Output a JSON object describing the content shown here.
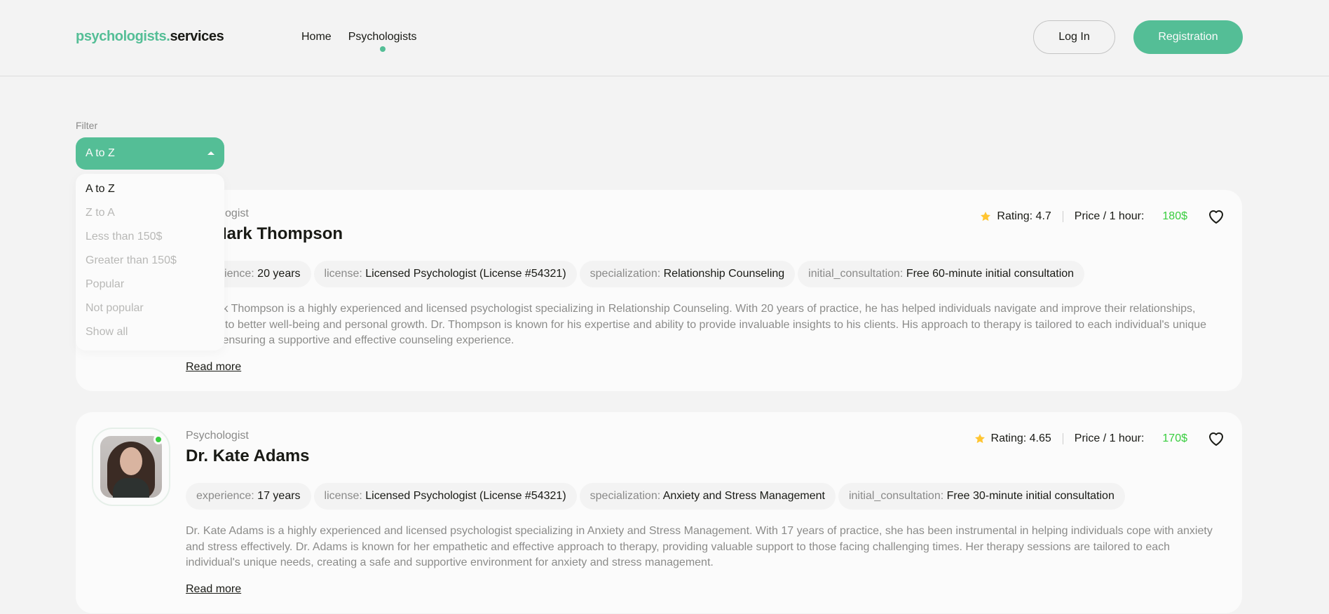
{
  "header": {
    "logo_accent": "psychologists.",
    "logo_rest": "services",
    "nav": [
      {
        "label": "Home",
        "active": false
      },
      {
        "label": "Psychologists",
        "active": true
      }
    ],
    "login_label": "Log In",
    "register_label": "Registration"
  },
  "filter": {
    "label": "Filter",
    "selected": "A to Z",
    "options": [
      "A to Z",
      "Z to A",
      "Less than 150$",
      "Greater than 150$",
      "Popular",
      "Not popular",
      "Show all"
    ]
  },
  "cards": [
    {
      "role": "Psychologist",
      "name": "Dr. Mark Thompson",
      "rating_text": "Rating: 4.7",
      "price_label": "Price / 1 hour:",
      "price": "180$",
      "online": true,
      "tags": [
        {
          "key": "experience",
          "value": "20 years"
        },
        {
          "key": "license",
          "value": "Licensed Psychologist (License #54321)"
        },
        {
          "key": "specialization",
          "value": "Relationship Counseling"
        },
        {
          "key": "initial_consultation",
          "value": "Free 60-minute initial consultation"
        }
      ],
      "description": "Dr. Mark Thompson is a highly experienced and licensed psychologist specializing in Relationship Counseling. With 20 years of practice, he has helped individuals navigate and improve their relationships, leading to better well-being and personal growth. Dr. Thompson is known for his expertise and ability to provide invaluable insights to his clients. His approach to therapy is tailored to each individual's unique needs, ensuring a supportive and effective counseling experience.",
      "read_more": "Read more"
    },
    {
      "role": "Psychologist",
      "name": "Dr. Kate Adams",
      "rating_text": "Rating: 4.65",
      "price_label": "Price / 1 hour:",
      "price": "170$",
      "online": true,
      "tags": [
        {
          "key": "experience",
          "value": "17 years"
        },
        {
          "key": "license",
          "value": "Licensed Psychologist (License #54321)"
        },
        {
          "key": "specialization",
          "value": "Anxiety and Stress Management"
        },
        {
          "key": "initial_consultation",
          "value": "Free 30-minute initial consultation"
        }
      ],
      "description": "Dr. Kate Adams is a highly experienced and licensed psychologist specializing in Anxiety and Stress Management. With 17 years of practice, she has been instrumental in helping individuals cope with anxiety and stress effectively. Dr. Adams is known for her empathetic and effective approach to therapy, providing valuable support to those facing challenging times. Her therapy sessions are tailored to each individual's unique needs, creating a safe and supportive environment for anxiety and stress management.",
      "read_more": "Read more"
    }
  ],
  "colors": {
    "accent": "#54be96",
    "price": "#38cd3e",
    "star": "#ffc531",
    "background": "#f3f3f3",
    "card": "#fbfbfb"
  },
  "icons": {
    "rating": "star-icon",
    "favorite": "heart-icon",
    "dropdown": "caret-up-icon"
  }
}
